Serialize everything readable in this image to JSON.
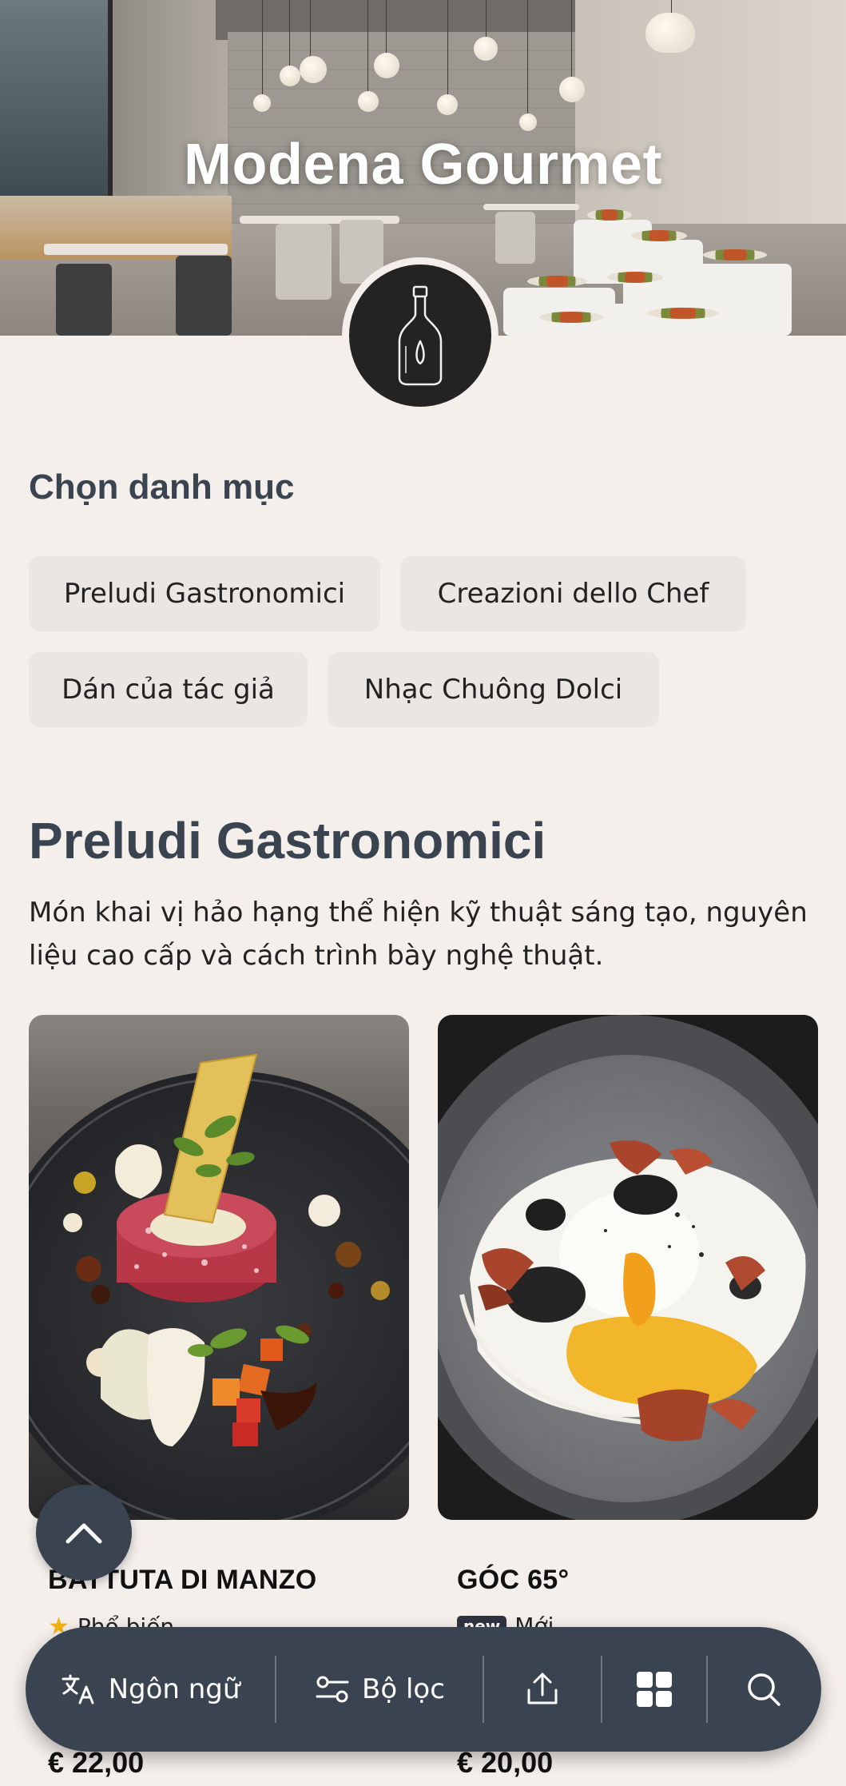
{
  "hero": {
    "title": "Modena Gourmet"
  },
  "logo": {
    "icon": "bottle-icon"
  },
  "categories": {
    "heading": "Chọn danh mục",
    "chips": [
      "Preludi Gastronomici",
      "Creazioni dello Chef",
      "Dán của tác giả",
      "Nhạc Chuông Dolci"
    ]
  },
  "section": {
    "title": "Preludi Gastronomici",
    "description": "Món khai vị hảo hạng thể hiện kỹ thuật sáng tạo, nguyên liệu cao cấp và cách trình bày nghệ thuật."
  },
  "items": [
    {
      "name": "BATTUTA DI MANZO",
      "tag": "Phổ biến",
      "tag_icon": "star-icon",
      "price": "€ 22,00"
    },
    {
      "name": "GÓC 65°",
      "badge": "new",
      "tag": "Mới",
      "price": "€ 20,00"
    }
  ],
  "bottom_bar": {
    "language_label": "Ngôn ngữ",
    "filter_label": "Bộ lọc",
    "share_icon": "share-icon",
    "grid_icon": "grid-icon",
    "search_icon": "search-icon"
  },
  "colors": {
    "background": "#f5efeb",
    "chip": "#ece6e2",
    "accent_dark": "#3a4450",
    "star": "#f2b315"
  }
}
